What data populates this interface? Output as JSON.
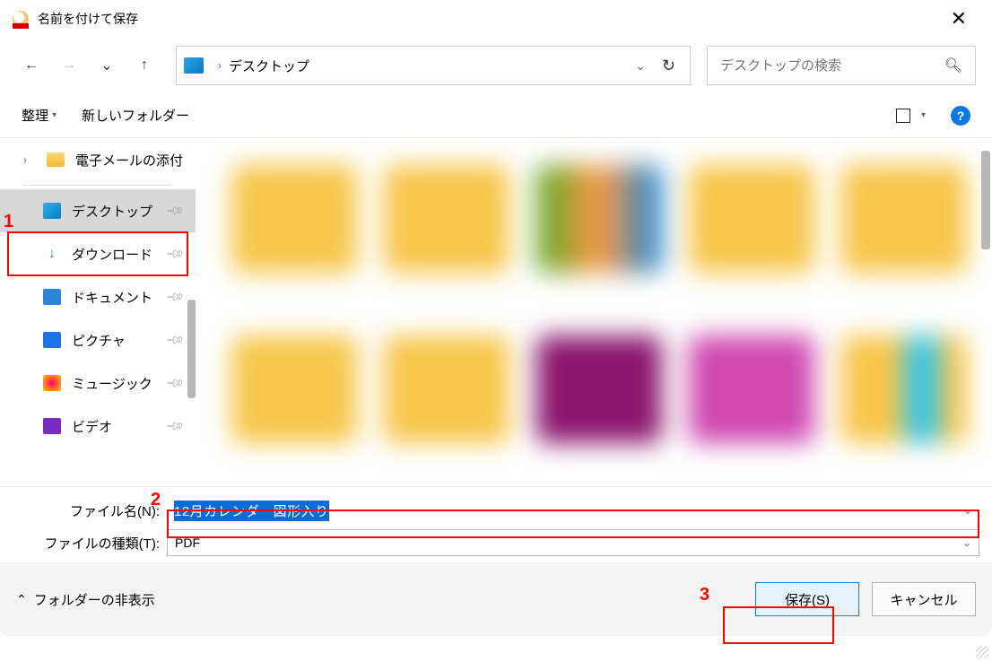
{
  "title": "名前を付けて保存",
  "breadcrumb": {
    "location": "デスクトップ"
  },
  "search": {
    "placeholder": "デスクトップの検索"
  },
  "toolbar": {
    "organize": "整理",
    "new_folder": "新しいフォルダー"
  },
  "sidebar": {
    "root": "電子メールの添付",
    "items": [
      {
        "label": "デスクトップ"
      },
      {
        "label": "ダウンロード"
      },
      {
        "label": "ドキュメント"
      },
      {
        "label": "ピクチャ"
      },
      {
        "label": "ミュージック"
      },
      {
        "label": "ビデオ"
      }
    ]
  },
  "form": {
    "filename_label": "ファイル名(N):",
    "filename_value": "12月カレンダー図形入り",
    "filetype_label": "ファイルの種類(T):",
    "filetype_value": "PDF"
  },
  "footer": {
    "hide_folders": "フォルダーの非表示",
    "save": "保存(S)",
    "cancel": "キャンセル"
  },
  "annotations": {
    "a1": "1",
    "a2": "2",
    "a3": "3"
  }
}
